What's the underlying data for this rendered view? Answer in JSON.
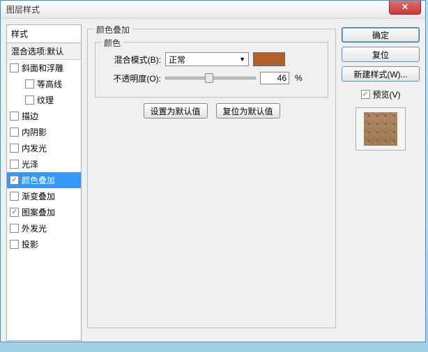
{
  "window": {
    "title": "图层样式"
  },
  "left": {
    "header": "样式",
    "default_label": "混合选项:默认",
    "items": [
      {
        "label": "斜面和浮雕",
        "checked": false,
        "indent": false
      },
      {
        "label": "等高线",
        "checked": false,
        "indent": true
      },
      {
        "label": "纹理",
        "checked": false,
        "indent": true
      },
      {
        "label": "描边",
        "checked": false,
        "indent": false
      },
      {
        "label": "内阴影",
        "checked": false,
        "indent": false
      },
      {
        "label": "内发光",
        "checked": false,
        "indent": false
      },
      {
        "label": "光泽",
        "checked": false,
        "indent": false
      },
      {
        "label": "颜色叠加",
        "checked": true,
        "indent": false,
        "selected": true
      },
      {
        "label": "渐变叠加",
        "checked": false,
        "indent": false
      },
      {
        "label": "图案叠加",
        "checked": true,
        "indent": false
      },
      {
        "label": "外发光",
        "checked": false,
        "indent": false
      },
      {
        "label": "投影",
        "checked": false,
        "indent": false
      }
    ]
  },
  "center": {
    "group_title": "颜色叠加",
    "inner_title": "颜色",
    "blend_label": "混合模式(B):",
    "blend_value": "正常",
    "opacity_label": "不透明度(O):",
    "opacity_value": "46",
    "opacity_unit": "%",
    "swatch_color": "#b06028",
    "btn_default": "设置为默认值",
    "btn_reset": "复位为默认值"
  },
  "right": {
    "ok": "确定",
    "cancel": "复位",
    "newstyle": "新建样式(W)...",
    "preview_label": "预览(V)"
  }
}
